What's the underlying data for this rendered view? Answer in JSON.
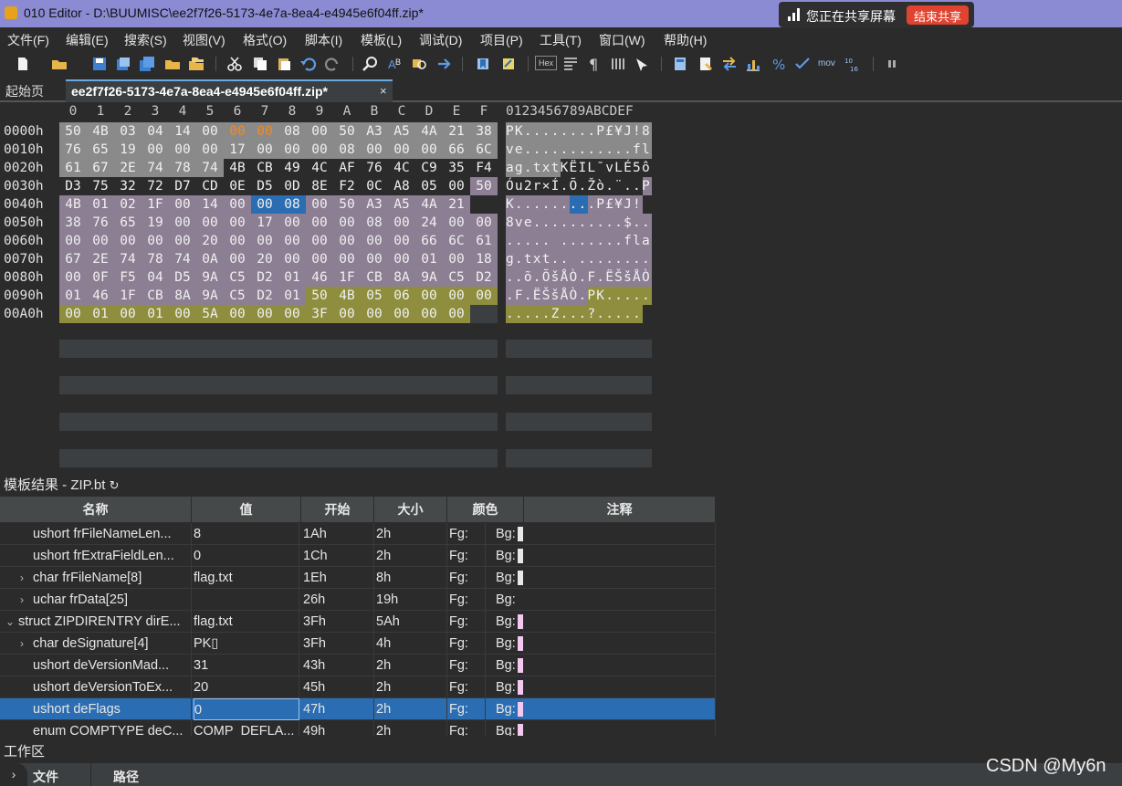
{
  "window": {
    "title": "010 Editor - D:\\BUUMISC\\ee2f7f26-5173-4e7a-8ea4-e4945e6f04ff.zip*"
  },
  "share": {
    "text": "您正在共享屏幕",
    "stop_label": "结束共享"
  },
  "menu": [
    "文件(F)",
    "编辑(E)",
    "搜索(S)",
    "视图(V)",
    "格式(O)",
    "脚本(I)",
    "模板(L)",
    "调试(D)",
    "项目(P)",
    "工具(T)",
    "窗口(W)",
    "帮助(H)"
  ],
  "toolbar": {
    "hex_label": "Hex",
    "mov_label": "mov"
  },
  "tabs": {
    "start": "起始页",
    "file": "ee2f7f26-5173-4e7a-8ea4-e4945e6f04ff.zip*",
    "close": "×"
  },
  "hex": {
    "columns": [
      "0",
      "1",
      "2",
      "3",
      "4",
      "5",
      "6",
      "7",
      "8",
      "9",
      "A",
      "B",
      "C",
      "D",
      "E",
      "F"
    ],
    "ascii_header": "0123456789ABCDEF",
    "rows": [
      {
        "addr": "0000h",
        "bytes": [
          "50",
          "4B",
          "03",
          "04",
          "14",
          "00",
          "00",
          "00",
          "08",
          "00",
          "50",
          "A3",
          "A5",
          "4A",
          "21",
          "38"
        ],
        "ascii": "PK........P£¥J!8"
      },
      {
        "addr": "0010h",
        "bytes": [
          "76",
          "65",
          "19",
          "00",
          "00",
          "00",
          "17",
          "00",
          "00",
          "00",
          "08",
          "00",
          "00",
          "00",
          "66",
          "6C"
        ],
        "ascii": "ve............fl"
      },
      {
        "addr": "0020h",
        "bytes": [
          "61",
          "67",
          "2E",
          "74",
          "78",
          "74",
          "4B",
          "CB",
          "49",
          "4C",
          "AF",
          "76",
          "4C",
          "C9",
          "35",
          "F4"
        ],
        "ascii": "ag.txtKËIL¯vLÉ5ô"
      },
      {
        "addr": "0030h",
        "bytes": [
          "D3",
          "75",
          "32",
          "72",
          "D7",
          "CD",
          "0E",
          "D5",
          "0D",
          "8E",
          "F2",
          "0C",
          "A8",
          "05",
          "00",
          "50"
        ],
        "ascii": "Óu2r×Í.Õ.Žò.¨..P"
      },
      {
        "addr": "0040h",
        "bytes": [
          "4B",
          "01",
          "02",
          "1F",
          "00",
          "14",
          "00",
          "00",
          "08",
          "00",
          "50",
          "A3",
          "A5",
          "4A",
          "21"
        ],
        "ascii": "K.........P£¥J!"
      },
      {
        "addr": "0050h",
        "bytes": [
          "38",
          "76",
          "65",
          "19",
          "00",
          "00",
          "00",
          "17",
          "00",
          "00",
          "00",
          "08",
          "00",
          "24",
          "00",
          "00"
        ],
        "ascii": "8ve..........$.."
      },
      {
        "addr": "0060h",
        "bytes": [
          "00",
          "00",
          "00",
          "00",
          "00",
          "20",
          "00",
          "00",
          "00",
          "00",
          "00",
          "00",
          "00",
          "66",
          "6C",
          "61"
        ],
        "ascii": "..... .......fla"
      },
      {
        "addr": "0070h",
        "bytes": [
          "67",
          "2E",
          "74",
          "78",
          "74",
          "0A",
          "00",
          "20",
          "00",
          "00",
          "00",
          "00",
          "00",
          "01",
          "00",
          "18"
        ],
        "ascii": "g.txt.. ........"
      },
      {
        "addr": "0080h",
        "bytes": [
          "00",
          "0F",
          "F5",
          "04",
          "D5",
          "9A",
          "C5",
          "D2",
          "01",
          "46",
          "1F",
          "CB",
          "8A",
          "9A",
          "C5",
          "D2"
        ],
        "ascii": "..õ.ÕšÅÒ.F.ËŠšÅÒ"
      },
      {
        "addr": "0090h",
        "bytes": [
          "01",
          "46",
          "1F",
          "CB",
          "8A",
          "9A",
          "C5",
          "D2",
          "01",
          "50",
          "4B",
          "05",
          "06",
          "00",
          "00",
          "00"
        ],
        "ascii": ".F.ËŠšÅÒ.PK....."
      },
      {
        "addr": "00A0h",
        "bytes": [
          "00",
          "01",
          "00",
          "01",
          "00",
          "5A",
          "00",
          "00",
          "00",
          "3F",
          "00",
          "00",
          "00",
          "00",
          "00"
        ],
        "ascii": ".....Z...?....."
      }
    ]
  },
  "template": {
    "title": "模板结果 - ZIP.bt",
    "refresh_icon": "↻",
    "headers": [
      "名称",
      "值",
      "开始",
      "大小",
      "颜色",
      "注释"
    ],
    "rows": [
      {
        "expander": "",
        "name": "ushort frFileNameLen...",
        "value": "8",
        "start": "1Ah",
        "size": "2h",
        "fg": "Fg:",
        "bg": "Bg:",
        "swatch": "#e8e8e8"
      },
      {
        "expander": "",
        "name": "ushort frExtraFieldLen...",
        "value": "0",
        "start": "1Ch",
        "size": "2h",
        "fg": "Fg:",
        "bg": "Bg:",
        "swatch": "#e8e8e8"
      },
      {
        "expander": ">",
        "name": "char frFileName[8]",
        "value": "flag.txt",
        "start": "1Eh",
        "size": "8h",
        "fg": "Fg:",
        "bg": "Bg:",
        "swatch": "#e8e8e8"
      },
      {
        "expander": ">",
        "name": "uchar frData[25]",
        "value": "",
        "start": "26h",
        "size": "19h",
        "fg": "Fg:",
        "bg": "Bg:",
        "swatch": ""
      },
      {
        "expander": "v",
        "name": "struct ZIPDIRENTRY dirE...",
        "value": "flag.txt",
        "start": "3Fh",
        "size": "5Ah",
        "fg": "Fg:",
        "bg": "Bg:",
        "swatch": "#f4c8ef"
      },
      {
        "expander": ">",
        "name": "char deSignature[4]",
        "value": "PK▯",
        "start": "3Fh",
        "size": "4h",
        "fg": "Fg:",
        "bg": "Bg:",
        "swatch": "#f4c8ef"
      },
      {
        "expander": "",
        "name": "ushort deVersionMad...",
        "value": "31",
        "start": "43h",
        "size": "2h",
        "fg": "Fg:",
        "bg": "Bg:",
        "swatch": "#f4c8ef"
      },
      {
        "expander": "",
        "name": "ushort deVersionToEx...",
        "value": "20",
        "start": "45h",
        "size": "2h",
        "fg": "Fg:",
        "bg": "Bg:",
        "swatch": "#f4c8ef"
      },
      {
        "expander": "",
        "name": "ushort deFlags",
        "value": "0",
        "start": "47h",
        "size": "2h",
        "fg": "Fg:",
        "bg": "Bg:",
        "swatch": "#f4c8ef",
        "selected": true
      },
      {
        "expander": "",
        "name": "enum COMPTYPE deC...",
        "value": "COMP_DEFLA...",
        "start": "49h",
        "size": "2h",
        "fg": "Fg:",
        "bg": "Bg:",
        "swatch": "#f4c8ef"
      }
    ]
  },
  "workspace": {
    "title": "工作区",
    "columns": [
      "文件",
      "路径"
    ]
  },
  "watermark": "CSDN @My6n",
  "colors": {
    "gray_region": "#8a8a8a",
    "lavender_region": "#8c7e93",
    "olive_region": "#8e8e3e",
    "selection": "#2a6db2",
    "orange_text": "#f08a24"
  }
}
